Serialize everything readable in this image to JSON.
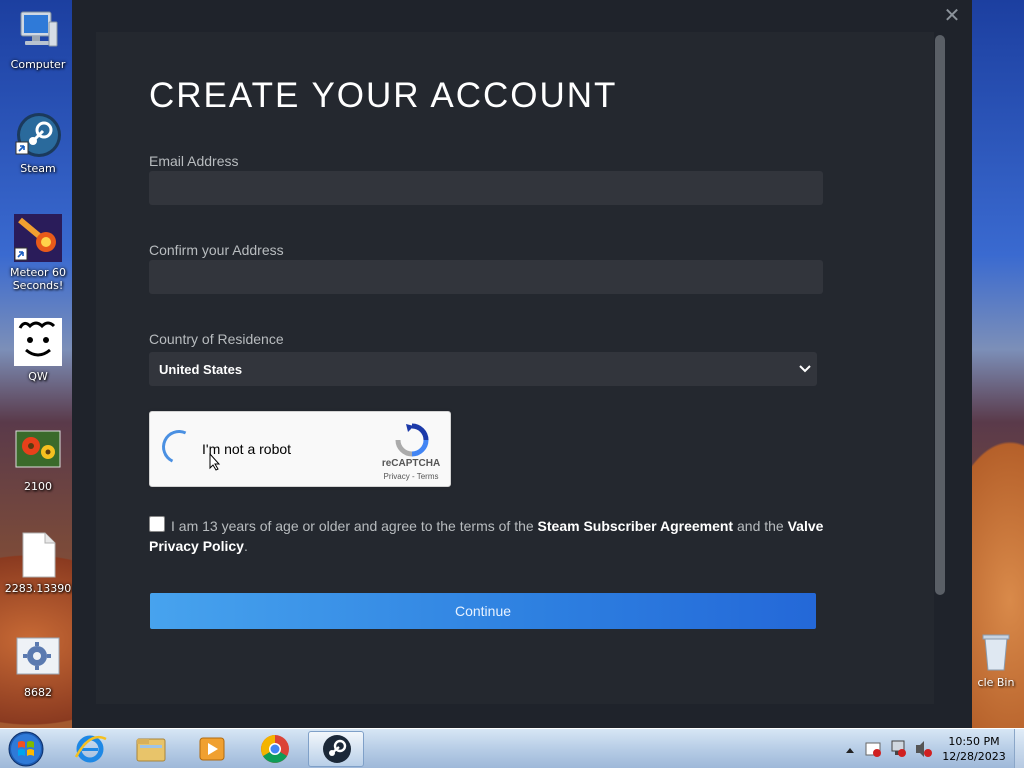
{
  "desktop": {
    "icons": [
      {
        "label": "Computer"
      },
      {
        "label": "Steam"
      },
      {
        "label": "Meteor 60 Seconds!"
      },
      {
        "label": "QW"
      },
      {
        "label": "2100"
      },
      {
        "label": "2283.13390"
      },
      {
        "label": "8682"
      }
    ],
    "recycle_bin_label": "cle Bin"
  },
  "steam": {
    "title": "CREATE YOUR ACCOUNT",
    "email_label": "Email Address",
    "email_value": "",
    "confirm_label": "Confirm your Address",
    "confirm_value": "",
    "country_label": "Country of Residence",
    "country_value": "United States",
    "captcha": {
      "text": "I'm not a robot",
      "brand": "reCAPTCHA",
      "terms": "Privacy - Terms"
    },
    "agree": {
      "text_before": "I am 13 years of age or older and agree to the terms of the",
      "link1": "Steam Subscriber Agreement",
      "text_mid": "and the",
      "link2": "Valve Privacy Policy",
      "text_end": "."
    },
    "continue_label": "Continue"
  },
  "taskbar": {
    "apps": [
      "internet-explorer",
      "file-explorer",
      "media-player",
      "chrome",
      "steam"
    ],
    "active_app": "steam",
    "clock": {
      "time": "10:50 PM",
      "date": "12/28/2023"
    }
  },
  "colors": {
    "window_bg": "#1f232b",
    "panel_bg": "#24282f",
    "input_bg": "#32353c",
    "button_start": "#47a3ee",
    "button_end": "#2468d8"
  }
}
